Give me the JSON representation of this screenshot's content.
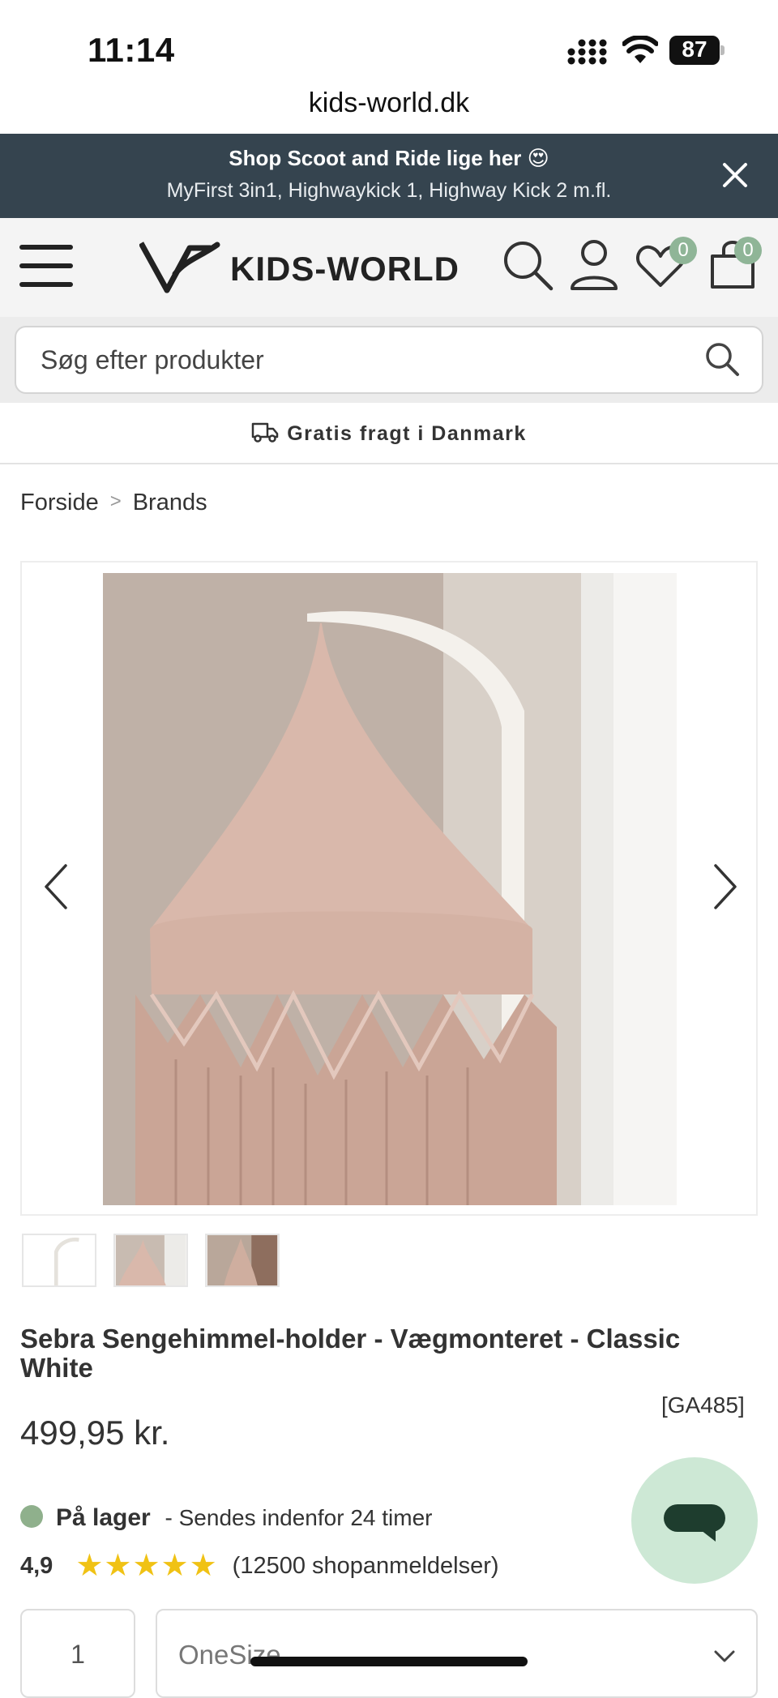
{
  "status_bar": {
    "time": "11:14",
    "battery": "87"
  },
  "browser": {
    "url": "kids-world.dk"
  },
  "promo": {
    "title": "Shop Scoot and Ride lige her 😍",
    "subtitle": "MyFirst 3in1, Highwaykick 1, Highway Kick 2 m.fl."
  },
  "header": {
    "logo_text": "KIDS-WORLD",
    "wishlist_count": "0",
    "cart_count": "0"
  },
  "search": {
    "placeholder": "Søg efter produkter"
  },
  "shipping": {
    "text": "Gratis fragt i Danmark"
  },
  "breadcrumb": {
    "items": [
      "Forside",
      "Brands"
    ]
  },
  "product": {
    "title": "Sebra Sengehimmel-holder - Vægmonteret - Classic White",
    "sku": "[GA485]",
    "price": "499,95 kr.",
    "stock_label": "På lager",
    "stock_note": "- Sendes indenfor 24 timer",
    "rating_score": "4,9",
    "rating_stars": "★★★★★",
    "rating_count": "(12500 shopanmeldelser)",
    "quantity": "1",
    "variant": "OneSize"
  },
  "colors": {
    "promo_bg": "#35444f",
    "badge": "#8fb597",
    "stock_dot": "#8fb08c",
    "star": "#f0c214",
    "chat_bg": "#cde8d5",
    "chat_icon": "#1e3d2e"
  },
  "icons": [
    "menu-icon",
    "search-icon",
    "account-icon",
    "heart-icon",
    "cart-icon",
    "close-icon",
    "truck-icon",
    "chevron-left-icon",
    "chevron-right-icon",
    "chat-icon",
    "chevron-down-icon"
  ]
}
